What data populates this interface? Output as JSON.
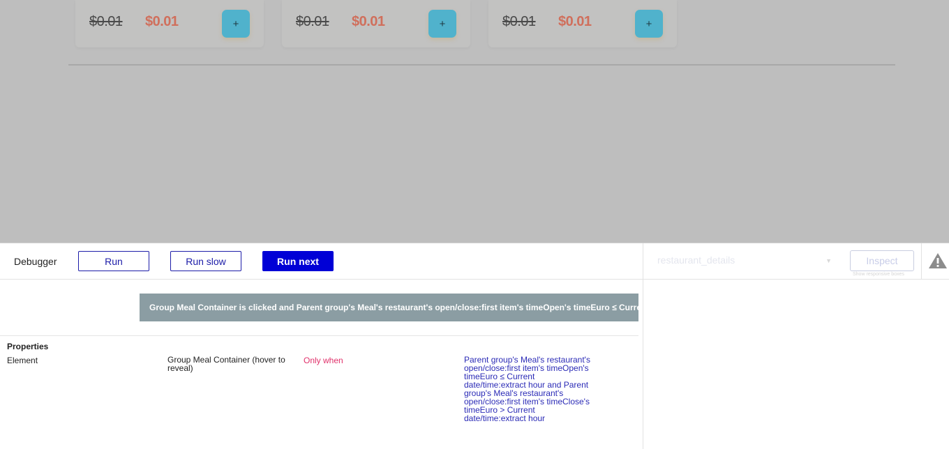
{
  "preview": {
    "cards": [
      {
        "old_price": "$0.01",
        "new_price": "$0.01",
        "add_label": "+"
      },
      {
        "old_price": "$0.01",
        "new_price": "$0.01",
        "add_label": "+"
      },
      {
        "old_price": "$0.01",
        "new_price": "$0.01",
        "add_label": "+"
      }
    ]
  },
  "debugger": {
    "title": "Debugger",
    "run_label": "Run",
    "run_slow_label": "Run slow",
    "run_next_label": "Run next",
    "element_select": "restaurant_details",
    "inspect_label": "Inspect",
    "inspect_sub": "Show responsive boxes",
    "warning_icon": "warning-icon",
    "event_text": "Group Meal Container is clicked and Parent group's Meal's restaurant's open/close:first item's timeOpen's timeEuro ≤ Current date/time:extract hour and Parent group's Meal's restaurant's open/close:first item's timeClose's timeEuro > Current date/time:extract hour",
    "properties_title": "Properties",
    "property": {
      "key": "Element",
      "value": "Group Meal Container (hover to reveal)",
      "condition_label": "Only when",
      "condition": "Parent group's Meal's restaurant's open/close:first item's timeOpen's timeEuro ≤ Current date/time:extract hour and Parent group's Meal's restaurant's open/close:first item's timeClose's timeEuro > Current date/time:extract hour"
    }
  },
  "colors": {
    "primary_button": "#0000d6",
    "event_bar": "#8b9da3",
    "sale_price": "#d06f5c",
    "add_button": "#50b2cc",
    "condition_label": "#e0306a",
    "condition_text": "#2a2ab6"
  }
}
